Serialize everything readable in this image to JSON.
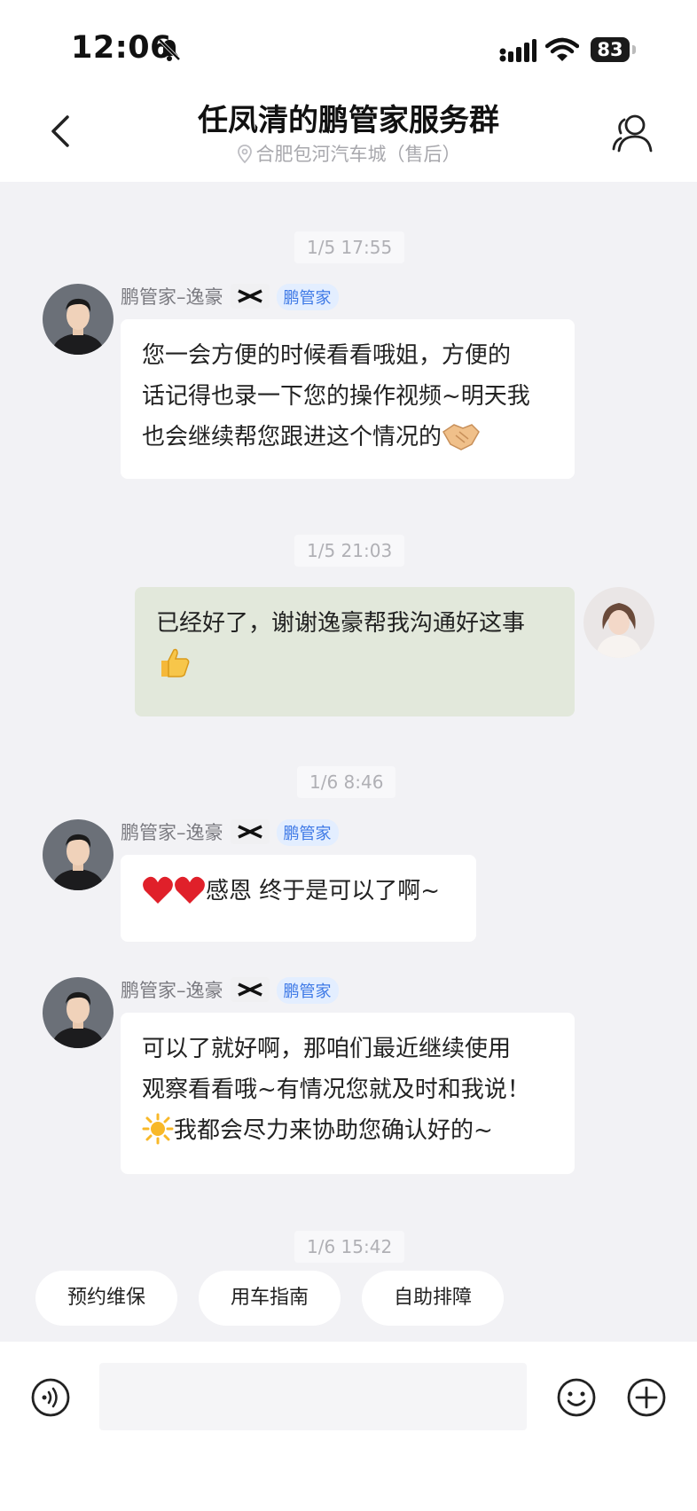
{
  "status_bar": {
    "time": "12:06",
    "battery": "83"
  },
  "header": {
    "title": "任凤清的鹏管家服务群",
    "subtitle": "合肥包河汽车城（售后）"
  },
  "messages": [
    {
      "timestamp": "1/5 17:55",
      "sender": "鹏管家–逸豪",
      "badge": "鹏管家",
      "lines": [
        "您一会方便的时候看看哦姐，方便的",
        "话记得也录一下您的操作视频~明天我",
        "也会继续帮您跟进这个情况的"
      ],
      "trailing_emoji": "handshake-emoji"
    },
    {
      "timestamp": "1/5 21:03",
      "lines": [
        "已经好了，谢谢逸豪帮我沟通好这事"
      ],
      "trailing_emoji": "thumbs-up-emoji"
    },
    {
      "timestamp": "1/6 8:46",
      "sender": "鹏管家–逸豪",
      "badge": "鹏管家",
      "leading_emoji": "heart-emoji",
      "lines": [
        "感恩 终于是可以了啊~"
      ]
    },
    {
      "sender": "鹏管家–逸豪",
      "badge": "鹏管家",
      "lines": [
        "可以了就好啊，那咱们最近继续使用",
        "观察看看哦~有情况您就及时和我说！",
        "我都会尽力来协助您确认好的~"
      ],
      "leading_emoji": "sun-emoji"
    },
    {
      "timestamp": "1/6 15:42"
    }
  ],
  "quick_actions": [
    "预约维保",
    "用车指南",
    "自助排障"
  ],
  "input": {
    "placeholder": ""
  },
  "colors": {
    "outgoing_bubble": "#e2e8db",
    "badge_text": "#3c78e6",
    "background": "#f2f2f5"
  }
}
